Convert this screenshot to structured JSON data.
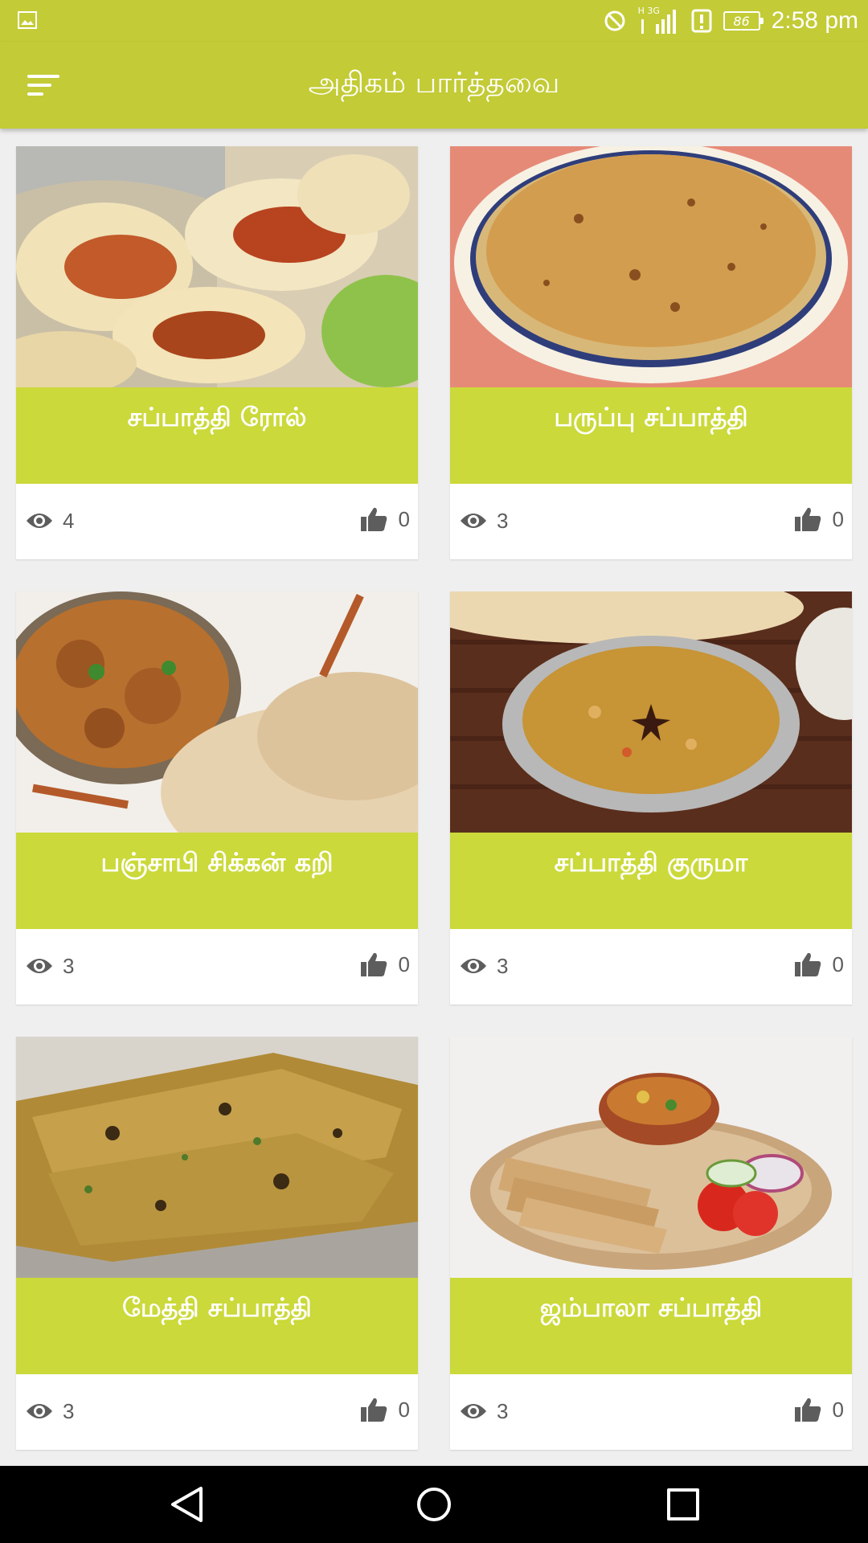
{
  "status_bar": {
    "network_label": "H 3G",
    "battery_level": "86",
    "time": "2:58 pm"
  },
  "toolbar": {
    "title": "அதிகம் பார்த்தவை",
    "menu_icon": "menu-icon"
  },
  "recipes": [
    {
      "title": "சப்பாத்தி ரோல்",
      "views": "4",
      "likes": "0"
    },
    {
      "title": "பருப்பு சப்பாத்தி",
      "views": "3",
      "likes": "0"
    },
    {
      "title": "பஞ்சாபி சிக்கன் கறி",
      "views": "3",
      "likes": "0"
    },
    {
      "title": "சப்பாத்தி குருமா",
      "views": "3",
      "likes": "0"
    },
    {
      "title": "மேத்தி சப்பாத்தி",
      "views": "3",
      "likes": "0"
    },
    {
      "title": "ஜம்பாலா சப்பாத்தி",
      "views": "3",
      "likes": "0"
    }
  ],
  "colors": {
    "accent": "#c3cb36",
    "banner": "#cbd93a",
    "background": "#efefef",
    "stat_text": "#5d5d5d"
  },
  "icons": {
    "views": "eye-icon",
    "likes": "thumbs-up-icon",
    "nav": [
      "back-icon",
      "home-icon",
      "recents-icon"
    ]
  }
}
